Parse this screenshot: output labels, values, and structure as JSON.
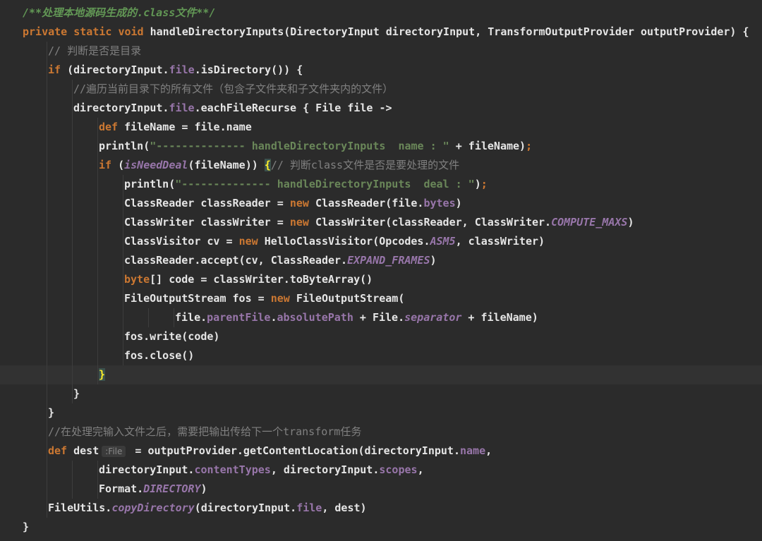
{
  "editor": {
    "lines": [
      {
        "indent": 0,
        "current": false,
        "tokens": [
          {
            "t": "/**处理本地源码生成的.class文件**/",
            "c": "doc"
          }
        ]
      },
      {
        "indent": 0,
        "current": false,
        "tokens": [
          {
            "t": "private static void ",
            "c": "kw"
          },
          {
            "t": "handleDirectoryInputs(DirectoryInput directoryInput, TransformOutputProvider outputProvider) {",
            "c": "pl"
          }
        ]
      },
      {
        "indent": 1,
        "current": false,
        "tokens": [
          {
            "t": "// 判断是否是目录",
            "c": "cm"
          }
        ]
      },
      {
        "indent": 1,
        "current": false,
        "tokens": [
          {
            "t": "if ",
            "c": "kw"
          },
          {
            "t": "(directoryInput.",
            "c": "pl"
          },
          {
            "t": "file",
            "c": "fld"
          },
          {
            "t": ".isDirectory()) {",
            "c": "pl"
          }
        ]
      },
      {
        "indent": 2,
        "current": false,
        "tokens": [
          {
            "t": "//遍历当前目录下的所有文件（包含子文件夹和子文件夹内的文件）",
            "c": "cm"
          }
        ]
      },
      {
        "indent": 2,
        "current": false,
        "tokens": [
          {
            "t": "directoryInput.",
            "c": "pl"
          },
          {
            "t": "file",
            "c": "fld"
          },
          {
            "t": ".eachFileRecurse { File file ->",
            "c": "pl"
          }
        ]
      },
      {
        "indent": 3,
        "current": false,
        "tokens": [
          {
            "t": "def ",
            "c": "kw"
          },
          {
            "t": "fileName = file.name",
            "c": "pl"
          }
        ]
      },
      {
        "indent": 3,
        "current": false,
        "tokens": [
          {
            "t": "println(",
            "c": "pl"
          },
          {
            "t": "\"-------------- handleDirectoryInputs  name : \"",
            "c": "str"
          },
          {
            "t": " + fileName)",
            "c": "pl"
          },
          {
            "t": ";",
            "c": "kw"
          }
        ]
      },
      {
        "indent": 3,
        "current": false,
        "tokens": [
          {
            "t": "if ",
            "c": "kw"
          },
          {
            "t": "(",
            "c": "pl"
          },
          {
            "t": "isNeedDeal",
            "c": "sfld"
          },
          {
            "t": "(fileName)) ",
            "c": "pl"
          },
          {
            "t": "{",
            "c": "brace"
          },
          {
            "t": "// 判断class文件是否是要处理的文件",
            "c": "cm"
          }
        ]
      },
      {
        "indent": 4,
        "current": false,
        "tokens": [
          {
            "t": "println(",
            "c": "pl"
          },
          {
            "t": "\"-------------- handleDirectoryInputs  deal : \"",
            "c": "str"
          },
          {
            "t": ")",
            "c": "pl"
          },
          {
            "t": ";",
            "c": "kw"
          }
        ]
      },
      {
        "indent": 4,
        "current": false,
        "tokens": [
          {
            "t": "ClassReader classReader = ",
            "c": "pl"
          },
          {
            "t": "new ",
            "c": "kw"
          },
          {
            "t": "ClassReader(file.",
            "c": "pl"
          },
          {
            "t": "bytes",
            "c": "fld"
          },
          {
            "t": ")",
            "c": "pl"
          }
        ]
      },
      {
        "indent": 4,
        "current": false,
        "tokens": [
          {
            "t": "ClassWriter classWriter = ",
            "c": "pl"
          },
          {
            "t": "new ",
            "c": "kw"
          },
          {
            "t": "ClassWriter(classReader, ClassWriter.",
            "c": "pl"
          },
          {
            "t": "COMPUTE_MAXS",
            "c": "sfld"
          },
          {
            "t": ")",
            "c": "pl"
          }
        ]
      },
      {
        "indent": 4,
        "current": false,
        "tokens": [
          {
            "t": "ClassVisitor cv = ",
            "c": "pl"
          },
          {
            "t": "new ",
            "c": "kw"
          },
          {
            "t": "HelloClassVisitor(Opcodes.",
            "c": "pl"
          },
          {
            "t": "ASM5",
            "c": "sfld"
          },
          {
            "t": ", classWriter)",
            "c": "pl"
          }
        ]
      },
      {
        "indent": 4,
        "current": false,
        "tokens": [
          {
            "t": "classReader.accept(cv, ClassReader.",
            "c": "pl"
          },
          {
            "t": "EXPAND_FRAMES",
            "c": "sfld"
          },
          {
            "t": ")",
            "c": "pl"
          }
        ]
      },
      {
        "indent": 4,
        "current": false,
        "tokens": [
          {
            "t": "byte",
            "c": "kw"
          },
          {
            "t": "[] code = classWriter.toByteArray()",
            "c": "pl"
          }
        ]
      },
      {
        "indent": 4,
        "current": false,
        "tokens": [
          {
            "t": "FileOutputStream fos = ",
            "c": "pl"
          },
          {
            "t": "new ",
            "c": "kw"
          },
          {
            "t": "FileOutputStream(",
            "c": "pl"
          }
        ]
      },
      {
        "indent": 6,
        "current": false,
        "tokens": [
          {
            "t": "file.",
            "c": "pl"
          },
          {
            "t": "parentFile",
            "c": "fld"
          },
          {
            "t": ".",
            "c": "pl"
          },
          {
            "t": "absolutePath",
            "c": "fld"
          },
          {
            "t": " + File.",
            "c": "pl"
          },
          {
            "t": "separator",
            "c": "sfld"
          },
          {
            "t": " + fileName)",
            "c": "pl"
          }
        ]
      },
      {
        "indent": 4,
        "current": false,
        "tokens": [
          {
            "t": "fos.write(code)",
            "c": "pl"
          }
        ]
      },
      {
        "indent": 4,
        "current": false,
        "tokens": [
          {
            "t": "fos.close()",
            "c": "pl"
          }
        ]
      },
      {
        "indent": 3,
        "current": true,
        "tokens": [
          {
            "t": "}",
            "c": "brace"
          }
        ]
      },
      {
        "indent": 2,
        "current": false,
        "tokens": [
          {
            "t": "}",
            "c": "pl"
          }
        ]
      },
      {
        "indent": 1,
        "current": false,
        "tokens": [
          {
            "t": "}",
            "c": "pl"
          }
        ]
      },
      {
        "indent": 1,
        "current": false,
        "tokens": [
          {
            "t": "//在处理完输入文件之后，需要把输出传给下一个transform任务",
            "c": "cm"
          }
        ]
      },
      {
        "indent": 1,
        "current": false,
        "tokens": [
          {
            "t": "def ",
            "c": "kw"
          },
          {
            "t": "dest",
            "c": "pl"
          },
          {
            "t": ":File",
            "c": "hint"
          },
          {
            "t": " = outputProvider.getContentLocation(directoryInput.",
            "c": "pl"
          },
          {
            "t": "name",
            "c": "fld"
          },
          {
            "t": ",",
            "c": "pl"
          }
        ]
      },
      {
        "indent": 3,
        "current": false,
        "tokens": [
          {
            "t": "directoryInput.",
            "c": "pl"
          },
          {
            "t": "contentTypes",
            "c": "fld"
          },
          {
            "t": ", directoryInput.",
            "c": "pl"
          },
          {
            "t": "scopes",
            "c": "fld"
          },
          {
            "t": ",",
            "c": "pl"
          }
        ]
      },
      {
        "indent": 3,
        "current": false,
        "tokens": [
          {
            "t": "Format.",
            "c": "pl"
          },
          {
            "t": "DIRECTORY",
            "c": "sfld"
          },
          {
            "t": ")",
            "c": "pl"
          }
        ]
      },
      {
        "indent": 1,
        "current": false,
        "tokens": [
          {
            "t": "FileUtils.",
            "c": "pl"
          },
          {
            "t": "copyDirectory",
            "c": "sfld"
          },
          {
            "t": "(directoryInput.",
            "c": "pl"
          },
          {
            "t": "file",
            "c": "fld"
          },
          {
            "t": ", dest)",
            "c": "pl"
          }
        ]
      },
      {
        "indent": 0,
        "current": false,
        "tokens": [
          {
            "t": "}",
            "c": "pl"
          }
        ]
      }
    ]
  }
}
